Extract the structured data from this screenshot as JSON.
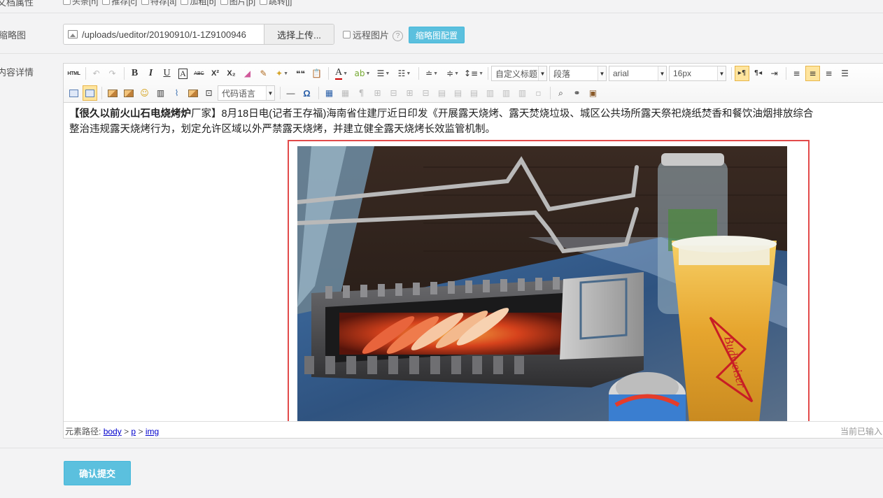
{
  "attributes": {
    "label": "文档属性",
    "items": [
      "头条[h]",
      "推荐[c]",
      "特荐[a]",
      "加粗[b]",
      "图片[p]",
      "跳转[j]"
    ]
  },
  "thumbnail": {
    "label": "缩略图",
    "path_value": "/uploads/ueditor/20190910/1-1Z9100946",
    "upload_label": "选择上传...",
    "remote_label": "远程图片",
    "help_glyph": "?",
    "config_label": "缩略图配置"
  },
  "content": {
    "label": "内容详情"
  },
  "toolbar": {
    "html_label": "HTML",
    "bold": "B",
    "italic": "I",
    "underline": "U",
    "fontborder": "A",
    "strike": "ABC",
    "superscript": "X²",
    "subscript": "X₂",
    "quote": "❝❝",
    "forecolor": "A",
    "heading_combo": "自定义标题",
    "paragraph_combo": "段落",
    "fontfamily_combo": "arial",
    "fontsize_combo": "16px",
    "code_combo": "代码语言",
    "horizontal_rule": "—",
    "special_char": "Ω"
  },
  "article": {
    "title_bold": "【很久以前火山石电烧烤炉",
    "title_end": "厂家】",
    "body_line1": "8月18日电(记者王存福)海南省住建厅近日印发《开展露天烧烤、露天焚烧垃圾、城区公共场所露天祭祀烧纸焚香和餐饮油烟排放综合",
    "body_line2": "整治违规露天烧烤行为，划定允许区域以外严禁露天烧烤，并建立健全露天烧烤长效监管机制。"
  },
  "statusbar": {
    "path_label": "元素路径:",
    "path": [
      "body",
      "p",
      "img"
    ],
    "path_separator": ">",
    "word_count": "当前已输入"
  },
  "submit": {
    "label": "确认提交"
  },
  "photo": {
    "beer_logo_text": "Budweiser"
  }
}
